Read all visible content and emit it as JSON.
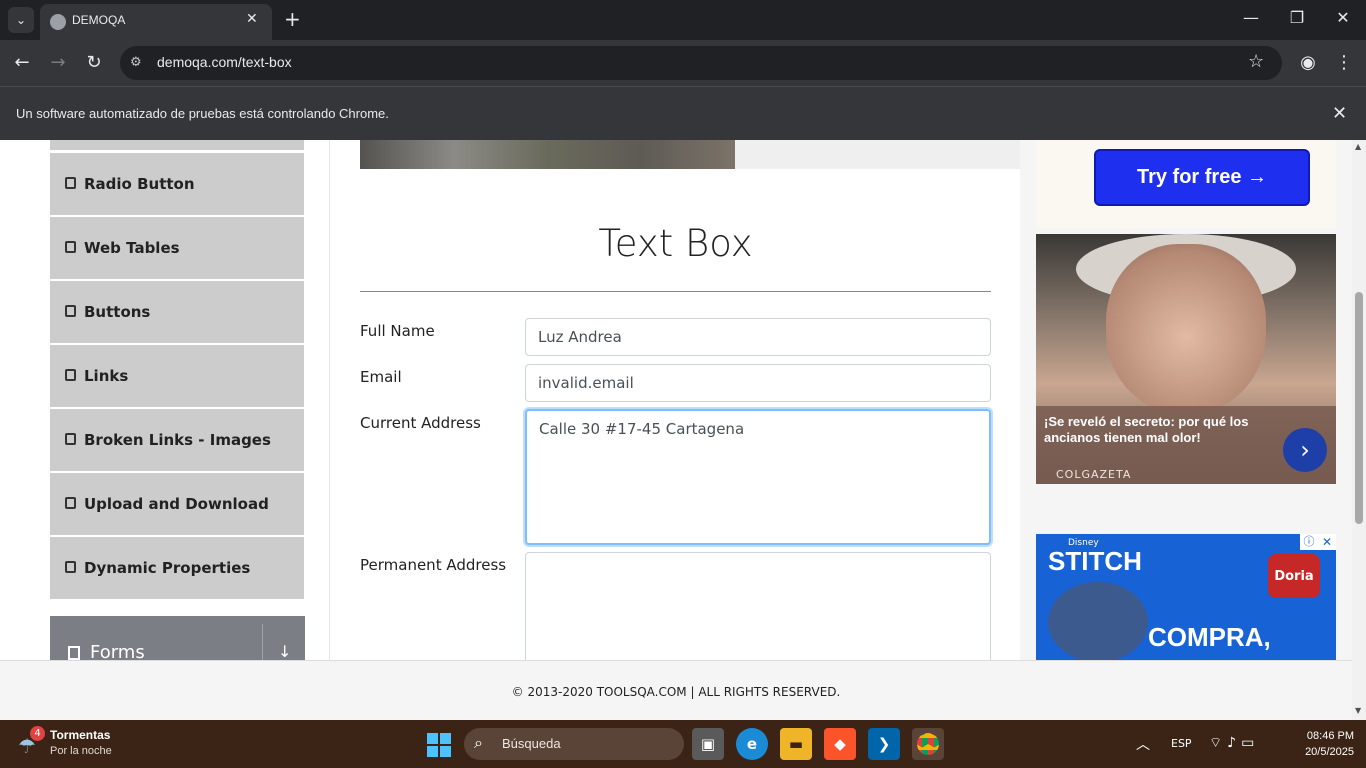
{
  "browser": {
    "tab_title": "DEMOQA",
    "url": "demoqa.com/text-box",
    "info_bar": "Un software automatizado de pruebas está controlando Chrome."
  },
  "sidebar": {
    "items": [
      {
        "label": "Radio Button"
      },
      {
        "label": "Web Tables"
      },
      {
        "label": "Buttons"
      },
      {
        "label": "Links"
      },
      {
        "label": "Broken Links - Images"
      },
      {
        "label": "Upload and Download"
      },
      {
        "label": "Dynamic Properties"
      }
    ],
    "group": "Forms"
  },
  "main": {
    "title": "Text Box",
    "fields": {
      "full_name_label": "Full Name",
      "full_name_value": "Luz Andrea",
      "email_label": "Email",
      "email_value": "invalid.email",
      "current_address_label": "Current Address",
      "current_address_value": "Calle 30 #17-45 Cartagena",
      "permanent_address_label": "Permanent Address",
      "permanent_address_value": ""
    }
  },
  "ads": {
    "try_button": "Try for free →",
    "ad2_text": "¡Se reveló el secreto: por qué los ancianos tienen mal olor!",
    "ad2_brand": "COLGAZETA",
    "ad3_disney": "Disney",
    "ad3_title": "STITCH",
    "ad3_brand": "Doria",
    "ad3_cta": "COMPRA,"
  },
  "footer": {
    "text": "© 2013-2020 TOOLSQA.COM | ALL RIGHTS RESERVED."
  },
  "taskbar": {
    "weather_count": "4",
    "weather_title": "Tormentas",
    "weather_sub": "Por la noche",
    "search": "Búsqueda",
    "lang": "ESP",
    "time": "08:46 PM",
    "date": "20/5/2025"
  }
}
